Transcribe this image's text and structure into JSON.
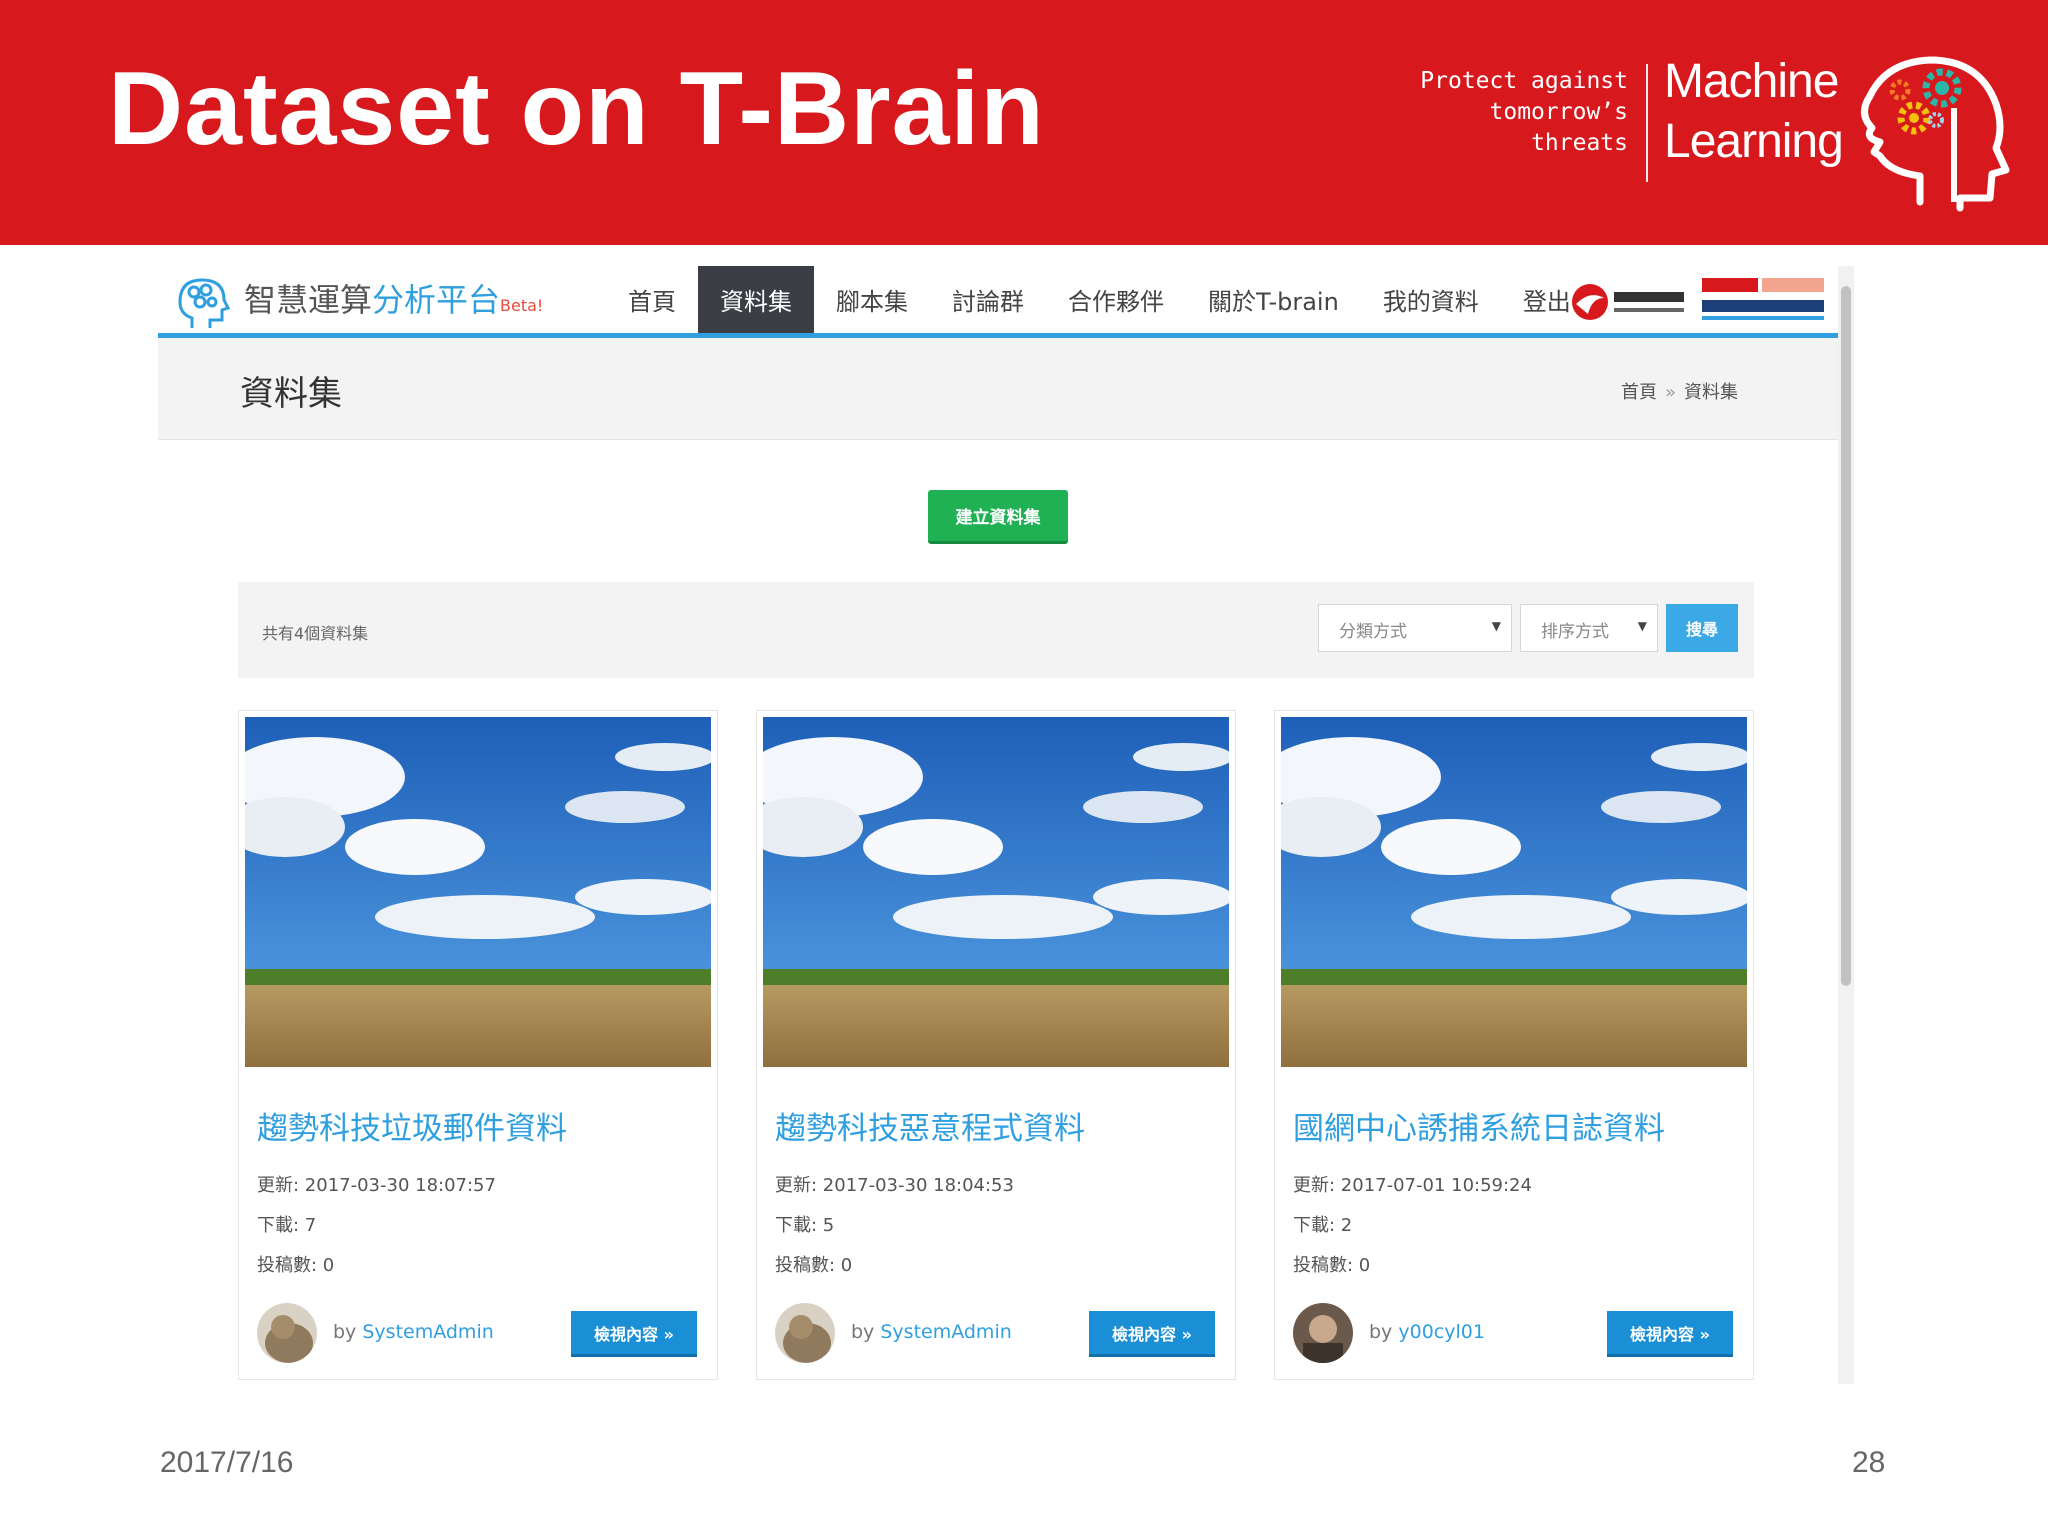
{
  "slide": {
    "title": "Dataset on T-Brain",
    "tagline": [
      "Protect against",
      "tomorrow’s",
      "threats"
    ],
    "ml_lines": [
      "Machine",
      "Learning"
    ],
    "date": "2017/7/16",
    "page_number": "28"
  },
  "browser": {
    "brand_main": "智慧運算",
    "brand_accent": "分析平台",
    "brand_beta": "Beta!",
    "nav_items": [
      {
        "label": "首頁",
        "active": false
      },
      {
        "label": "資料集",
        "active": true
      },
      {
        "label": "腳本集",
        "active": false
      },
      {
        "label": "討論群",
        "active": false
      },
      {
        "label": "合作夥伴",
        "active": false
      },
      {
        "label": "關於T-brain",
        "active": false
      },
      {
        "label": "我的資料",
        "active": false
      },
      {
        "label": "登出",
        "active": false
      }
    ],
    "page_title": "資料集",
    "breadcrumb": [
      "首頁",
      "資料集"
    ],
    "breadcrumb_sep": "»",
    "create_button": "建立資料集",
    "dataset_count": "共有4個資料集",
    "category_select": "分類方式",
    "sort_select": "排序方式",
    "search_button": "搜尋",
    "cards": [
      {
        "title": "趨勢科技垃圾郵件資料",
        "updated": "更新: 2017-03-30 18:07:57",
        "downloads": "下載: 7",
        "submissions": "投稿數: 0",
        "by": "by",
        "user": "SystemAdmin",
        "view_button": "檢視內容 »"
      },
      {
        "title": "趨勢科技惡意程式資料",
        "updated": "更新: 2017-03-30 18:04:53",
        "downloads": "下載: 5",
        "submissions": "投稿數: 0",
        "by": "by",
        "user": "SystemAdmin",
        "view_button": "檢視內容 »"
      },
      {
        "title": "國網中心誘捕系統日誌資料",
        "updated": "更新: 2017-07-01 10:59:24",
        "downloads": "下載: 2",
        "submissions": "投稿數: 0",
        "by": "by",
        "user": "y00cyl01",
        "view_button": "檢視內容 »"
      }
    ]
  },
  "colors": {
    "header_red": "#d7191e",
    "nav_active": "#3b3f45",
    "accent_blue": "#2f9fe0",
    "create_green": "#1fb154",
    "view_blue": "#1a8fd6"
  }
}
